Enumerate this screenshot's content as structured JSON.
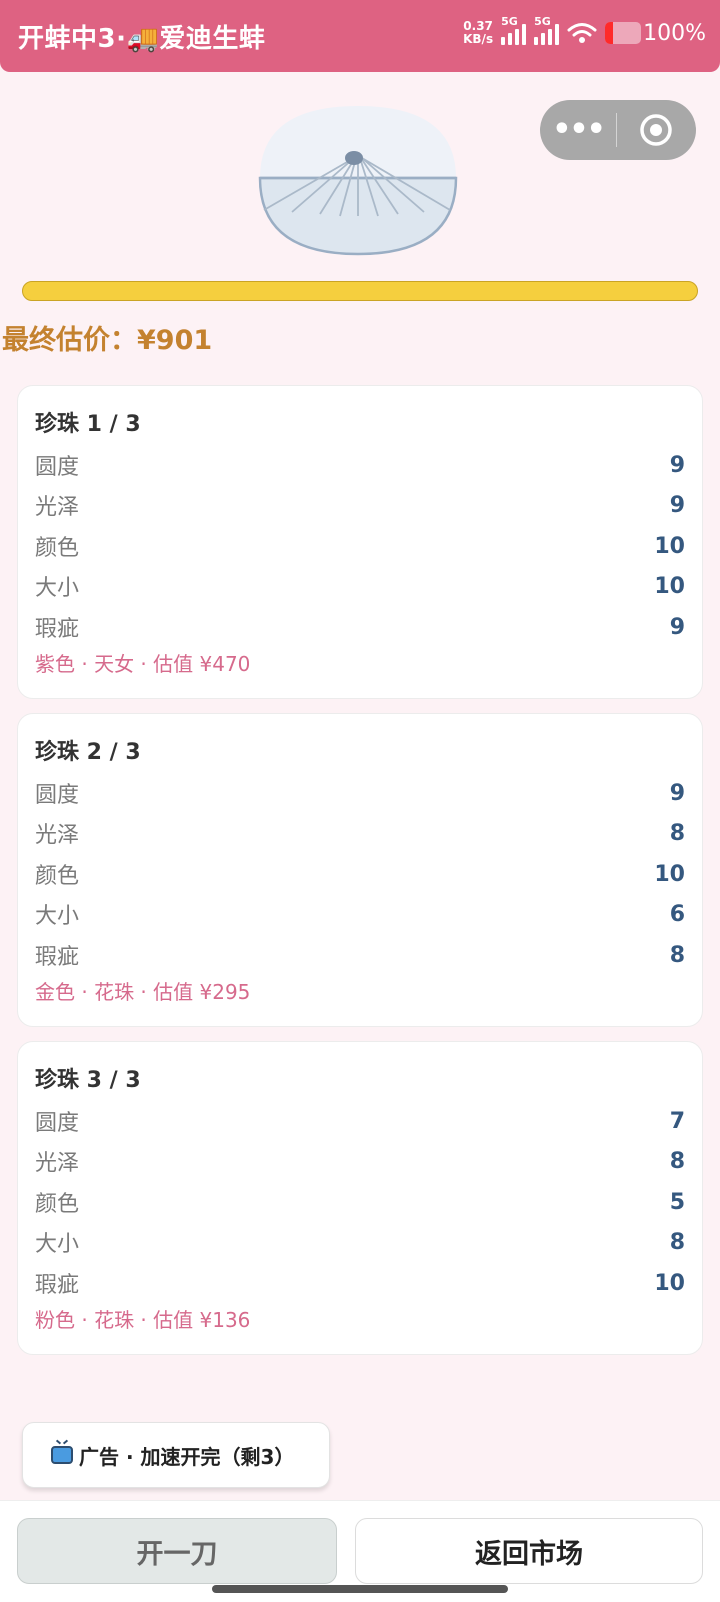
{
  "status": {
    "title": "开蚌中3·🚚爱迪生蚌",
    "net_speed": "0.37\nKB/s",
    "net_speed_top": "0.37",
    "net_speed_bottom": "KB/s",
    "gen1": "5G",
    "gen2": "5G",
    "battery": "100%"
  },
  "capsule": {
    "more_icon": "more-dots-icon",
    "close_icon": "target-circle-icon"
  },
  "progress": {
    "fraction": 1.0,
    "color": "#f5cf3e"
  },
  "final_price": "最终估价：¥901",
  "pearls": [
    {
      "title": "珍珠 1 / 3",
      "stats": [
        {
          "label": "圆度",
          "value": "9"
        },
        {
          "label": "光泽",
          "value": "9"
        },
        {
          "label": "颜色",
          "value": "10"
        },
        {
          "label": "大小",
          "value": "10"
        },
        {
          "label": "瑕疵",
          "value": "9"
        }
      ],
      "footer": "紫色 · 天女 · 估值 ¥470"
    },
    {
      "title": "珍珠 2 / 3",
      "stats": [
        {
          "label": "圆度",
          "value": "9"
        },
        {
          "label": "光泽",
          "value": "8"
        },
        {
          "label": "颜色",
          "value": "10"
        },
        {
          "label": "大小",
          "value": "6"
        },
        {
          "label": "瑕疵",
          "value": "8"
        }
      ],
      "footer": "金色 · 花珠 · 估值 ¥295"
    },
    {
      "title": "珍珠 3 / 3",
      "stats": [
        {
          "label": "圆度",
          "value": "7"
        },
        {
          "label": "光泽",
          "value": "8"
        },
        {
          "label": "颜色",
          "value": "5"
        },
        {
          "label": "大小",
          "value": "8"
        },
        {
          "label": "瑕疵",
          "value": "10"
        }
      ],
      "footer": "粉色 · 花珠 · 估值 ¥136"
    }
  ],
  "ad_button": {
    "icon": "tv-icon",
    "label": "广告 · 加速开完（剩3）"
  },
  "actions": {
    "cut_label": "开一刀",
    "back_label": "返回市场"
  },
  "colors": {
    "header": "#de6282",
    "value": "#35587f",
    "price": "#c4822f",
    "footer": "#d66a8c"
  }
}
